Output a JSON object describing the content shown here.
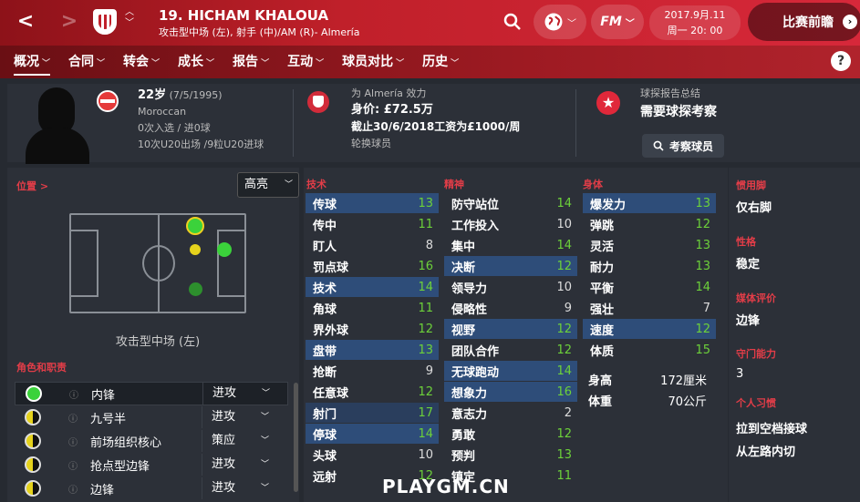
{
  "header": {
    "name": "19. HICHAM KHALOUA",
    "position_line": "攻击型中场 (左), 射手 (中)/AM (R)- Almería",
    "date_line1": "2017.9月.11",
    "date_line2": "周一 20: 00",
    "continue_label": "比赛前瞻",
    "fm_label": "FM",
    "back": "<",
    "forward": ">",
    "up": "︿",
    "down": "﹀"
  },
  "tabs": [
    "概况",
    "合同",
    "转会",
    "成长",
    "报告",
    "互动",
    "球员对比",
    "历史"
  ],
  "help": "?",
  "profile": {
    "age": "22岁",
    "dob": "(7/5/1995)",
    "nationality": "Moroccan",
    "caps": "0次入选 / 进0球",
    "u20": "10次U20出场 /9粒U20进球"
  },
  "club": {
    "plays_for": "为 Almería 效力",
    "value": "身价: £72.5万",
    "contract": "截止30/6/2018工资为£1000/周",
    "status": "轮换球员"
  },
  "scout": {
    "title": "球探报告总结",
    "need": "需要球探考察",
    "button": "考察球员"
  },
  "position_panel": {
    "label": "位置 >",
    "dropdown": "高亮",
    "caption": "攻击型中场 (左)",
    "roles_label": "角色和职责"
  },
  "roles": [
    {
      "name": "内锋",
      "duty": "进攻",
      "rating": "full",
      "selected": true
    },
    {
      "name": "九号半",
      "duty": "进攻",
      "rating": "half"
    },
    {
      "name": "前场组织核心",
      "duty": "策应",
      "rating": "half"
    },
    {
      "name": "抢点型边锋",
      "duty": "进攻",
      "rating": "half"
    },
    {
      "name": "边锋",
      "duty": "进攻",
      "rating": "half"
    }
  ],
  "attr_heads": {
    "technical": "技术",
    "mental": "精神",
    "physical": "身体"
  },
  "technical": [
    {
      "name": "传球",
      "value": "13",
      "hl": "hl"
    },
    {
      "name": "传中",
      "value": "11"
    },
    {
      "name": "盯人",
      "value": "8"
    },
    {
      "name": "罚点球",
      "value": "16"
    },
    {
      "name": "技术",
      "value": "14",
      "hl": "hl"
    },
    {
      "name": "角球",
      "value": "11"
    },
    {
      "name": "界外球",
      "value": "12"
    },
    {
      "name": "盘带",
      "value": "13",
      "hl": "hl"
    },
    {
      "name": "抢断",
      "value": "9"
    },
    {
      "name": "任意球",
      "value": "12"
    },
    {
      "name": "射门",
      "value": "17",
      "hl": "hl2"
    },
    {
      "name": "停球",
      "value": "14",
      "hl": "hl"
    },
    {
      "name": "头球",
      "value": "10"
    },
    {
      "name": "远射",
      "value": "12"
    }
  ],
  "mental": [
    {
      "name": "防守站位",
      "value": "14"
    },
    {
      "name": "工作投入",
      "value": "10"
    },
    {
      "name": "集中",
      "value": "14"
    },
    {
      "name": "决断",
      "value": "12",
      "hl": "hl"
    },
    {
      "name": "领导力",
      "value": "10"
    },
    {
      "name": "侵略性",
      "value": "9"
    },
    {
      "name": "视野",
      "value": "12",
      "hl": "hl"
    },
    {
      "name": "团队合作",
      "value": "12"
    },
    {
      "name": "无球跑动",
      "value": "14",
      "hl": "hl"
    },
    {
      "name": "想象力",
      "value": "16",
      "hl": "hl"
    },
    {
      "name": "意志力",
      "value": "2"
    },
    {
      "name": "勇敢",
      "value": "12"
    },
    {
      "name": "预判",
      "value": "13"
    },
    {
      "name": "镇定",
      "value": "11"
    }
  ],
  "physical": [
    {
      "name": "爆发力",
      "value": "13",
      "hl": "hl"
    },
    {
      "name": "弹跳",
      "value": "12"
    },
    {
      "name": "灵活",
      "value": "13"
    },
    {
      "name": "耐力",
      "value": "13"
    },
    {
      "name": "平衡",
      "value": "14"
    },
    {
      "name": "强壮",
      "value": "7"
    },
    {
      "name": "速度",
      "value": "12",
      "hl": "hl"
    },
    {
      "name": "体质",
      "value": "15"
    }
  ],
  "physical_extra": [
    {
      "name": "身高",
      "value": "172厘米"
    },
    {
      "name": "体重",
      "value": "70公斤"
    }
  ],
  "right": {
    "foot_label": "惯用脚",
    "foot": "仅右脚",
    "personality_label": "性格",
    "personality": "稳定",
    "media_label": "媒体评价",
    "media": "边锋",
    "gk_label": "守门能力",
    "gk": "3",
    "habits_label": "个人习惯",
    "habit1": "拉到空档接球",
    "habit2": "从左路内切"
  },
  "watermark": "PLAYGM.CN",
  "colors": {
    "accent": "#c0202a",
    "attr_label": "#e33d48",
    "value_green": "#6dd13a",
    "highlight_blue": "#2e4d79"
  }
}
